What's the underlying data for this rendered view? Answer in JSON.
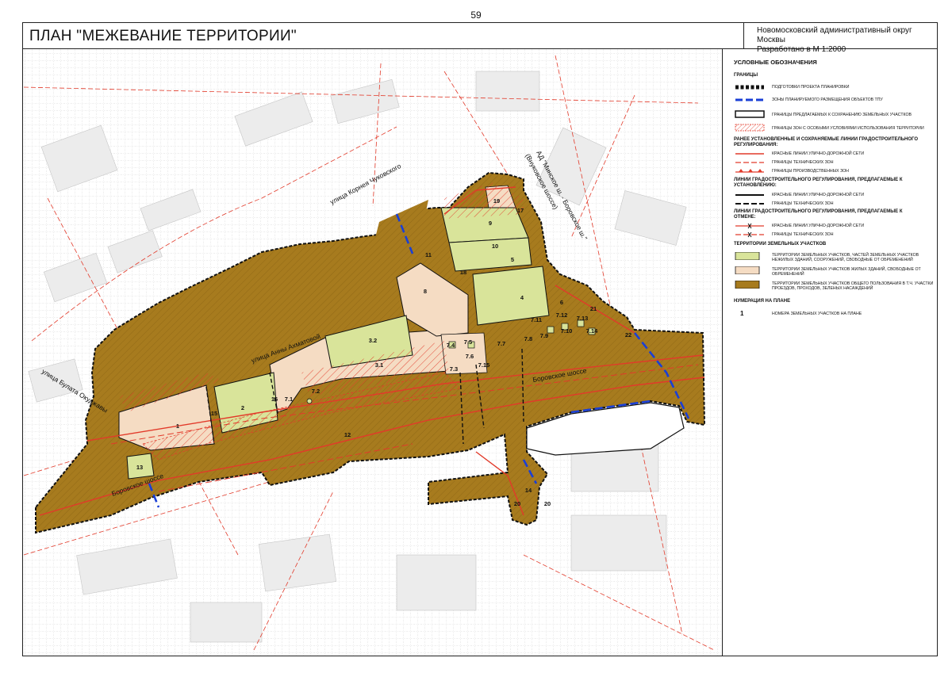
{
  "page_number": "59",
  "title": "ПЛАН \"МЕЖЕВАНИЕ ТЕРРИТОРИИ\"",
  "district": {
    "line1": "Новомосковский административный округ Москвы",
    "line2": "Разработано в М 1:2000"
  },
  "streets": {
    "korney": "улица Корнея Чуковского",
    "akhmatova": "улица Анны Ахматовой",
    "okudzhava": "улица Булата Окуджавы",
    "borovskoe_left": "Боровское шоссе",
    "borovskoe_right": "Боровское шоссе",
    "ad_minsk_1": "АД \"Минское ш. - Боровское ш.\"",
    "ad_minsk_2": "(Внуковское шоссе)"
  },
  "parcels": [
    {
      "id": "p1",
      "label": "1"
    },
    {
      "id": "p2",
      "label": "2"
    },
    {
      "id": "p3_1",
      "label": "3.1"
    },
    {
      "id": "p3_2",
      "label": "3.2"
    },
    {
      "id": "p4",
      "label": "4"
    },
    {
      "id": "p5",
      "label": "5"
    },
    {
      "id": "p6",
      "label": "6"
    },
    {
      "id": "p7_1",
      "label": "7.1"
    },
    {
      "id": "p7_2",
      "label": "7.2"
    },
    {
      "id": "p7_3",
      "label": "7.3"
    },
    {
      "id": "p7_4",
      "label": "7.4"
    },
    {
      "id": "p7_5",
      "label": "7.5"
    },
    {
      "id": "p7_6",
      "label": "7.6"
    },
    {
      "id": "p7_7",
      "label": "7.7"
    },
    {
      "id": "p7_8",
      "label": "7.8"
    },
    {
      "id": "p7_9",
      "label": "7.9"
    },
    {
      "id": "p7_10",
      "label": "7.10"
    },
    {
      "id": "p7_11",
      "label": "7.11"
    },
    {
      "id": "p7_12",
      "label": "7.12"
    },
    {
      "id": "p7_13",
      "label": "7.13"
    },
    {
      "id": "p7_14",
      "label": "7.14"
    },
    {
      "id": "p7_15",
      "label": "7.15"
    },
    {
      "id": "p8",
      "label": "8"
    },
    {
      "id": "p9",
      "label": "9"
    },
    {
      "id": "p10",
      "label": "10"
    },
    {
      "id": "p11",
      "label": "11"
    },
    {
      "id": "p12",
      "label": "12"
    },
    {
      "id": "p13",
      "label": "13"
    },
    {
      "id": "p14",
      "label": "14"
    },
    {
      "id": "p15",
      "label": "15"
    },
    {
      "id": "p16",
      "label": "16"
    },
    {
      "id": "p17",
      "label": "17"
    },
    {
      "id": "p18",
      "label": "18"
    },
    {
      "id": "p19",
      "label": "19"
    },
    {
      "id": "p20a",
      "label": "20"
    },
    {
      "id": "p20b",
      "label": "20"
    },
    {
      "id": "p21",
      "label": "21"
    },
    {
      "id": "p22",
      "label": "22"
    }
  ],
  "legend": {
    "title": "УСЛОВНЫЕ ОБОЗНАЧЕНИЯ",
    "sec_borders": "ГРАНИЦЫ",
    "border_planning": "ПОДГОТОВКИ ПРОЕКТА ПЛАНИРОВКИ",
    "border_tpu": "ЗОНЫ ПЛАНИРУЕМОГО РАЗМЕЩЕНИЯ ОБЪЕКТОВ ТПУ",
    "border_parcels": "ГРАНИЦЫ ПРЕДЛАГАЕМЫХ К СОХРАНЕНИЮ ЗЕМЕЛЬНЫХ УЧАСТКОВ",
    "border_special": "ГРАНИЦЫ ЗОН С ОСОБЫМИ УСЛОВИЯМИ ИСПОЛЬЗОВАНИЯ ТЕРРИТОРИИ",
    "sec_existing": "РАНЕЕ УСТАНОВЛЕННЫЕ И СОХРАНЯЕМЫЕ ЛИНИИ ГРАДОСТРОИТЕЛЬНОГО РЕГУЛИРОВАНИЯ:",
    "ex_red": "КРАСНЫЕ ЛИНИИ УЛИЧНО-ДОРОЖНОЙ СЕТИ",
    "ex_tech": "ГРАНИЦЫ ТЕХНИЧЕСКИХ ЗОН",
    "ex_prod": "ГРАНИЦЫ ПРОИЗВОДСТВЕННЫХ ЗОН",
    "sec_new": "ЛИНИИ ГРАДОСТРОИТЕЛЬНОГО РЕГУЛИРОВАНИЯ, ПРЕДЛАГАЕМЫЕ К УСТАНОВЛЕНИЮ:",
    "new_red": "КРАСНЫЕ ЛИНИИ УЛИЧНО-ДОРОЖНОЙ СЕТИ",
    "new_tech": "ГРАНИЦЫ ТЕХНИЧЕСКИХ ЗОН",
    "sec_cancel": "ЛИНИИ ГРАДОСТРОИТЕЛЬНОГО РЕГУЛИРОВАНИЯ, ПРЕДЛАГАЕМЫЕ К ОТМЕНЕ:",
    "cancel_red": "КРАСНЫЕ ЛИНИИ УЛИЧНО-ДОРОЖНОЙ СЕТИ",
    "cancel_tech": "ГРАНИЦЫ ТЕХНИЧЕСКИХ ЗОН",
    "sec_territories": "ТЕРРИТОРИИ ЗЕМЕЛЬНЫХ УЧАСТКОВ",
    "terr_green": "ТЕРРИТОРИИ ЗЕМЕЛЬНЫХ УЧАСТКОВ, ЧАСТЕЙ ЗЕМЕЛЬНЫХ УЧАСТКОВ НЕЖИЛЫХ ЗДАНИЙ, СООРУЖЕНИЙ, СВОБОДНЫЕ ОТ ОБРЕМЕНЕНИЙ",
    "terr_beige": "ТЕРРИТОРИИ ЗЕМЕЛЬНЫХ УЧАСТКОВ ЖИЛЫХ ЗДАНИЙ, СВОБОДНЫЕ ОТ ОБРЕМЕНЕНИЙ",
    "terr_brown": "ТЕРРИТОРИИ ЗЕМЕЛЬНЫХ УЧАСТКОВ ОБЩЕГО ПОЛЬЗОВАНИЯ В Т.Ч. УЧАСТКИ ПРОЕЗДОВ, ПРОХОДОВ, ЗЕЛЕНЫХ НАСАЖДЕНИЙ",
    "sec_numbering": "НУМЕРАЦИЯ НА ПЛАНЕ",
    "num_symbol": "1",
    "num_text": "НОМЕРА ЗЕМЕЛЬНЫХ УЧАСТКОВ НА ПЛАНЕ"
  },
  "colors": {
    "brown": "#a77b1e",
    "green": "#d9e49a",
    "beige": "#f5dcc3",
    "red": "#e23a2a",
    "blue": "#1a3fd6"
  }
}
